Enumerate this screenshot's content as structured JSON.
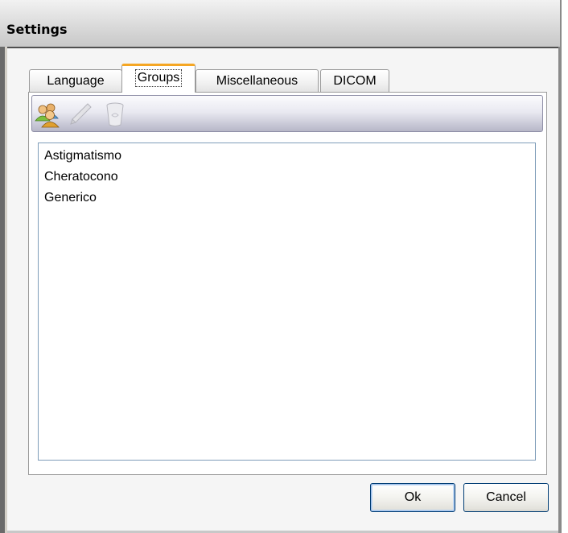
{
  "window": {
    "title": "Settings"
  },
  "tabs": [
    {
      "label": "Language",
      "active": false
    },
    {
      "label": "Groups",
      "active": true
    },
    {
      "label": "Miscellaneous",
      "active": false
    },
    {
      "label": "DICOM",
      "active": false
    }
  ],
  "toolbar": {
    "buttons": [
      {
        "icon": "users-group-icon",
        "enabled": true
      },
      {
        "icon": "pencil-icon",
        "enabled": false
      },
      {
        "icon": "trash-icon",
        "enabled": false
      }
    ]
  },
  "groups": {
    "items": [
      "Astigmatismo",
      "Cheratocono",
      "Generico"
    ]
  },
  "buttons": {
    "ok_label": "Ok",
    "cancel_label": "Cancel"
  },
  "colors": {
    "active_tab_accent": "#f5a623",
    "button_border": "#003c74",
    "list_border": "#7f9db9"
  }
}
